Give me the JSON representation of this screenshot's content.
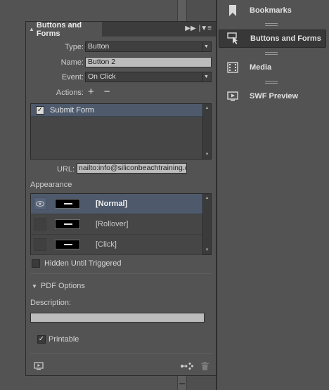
{
  "dock": {
    "items": [
      {
        "label": "Bookmarks",
        "icon": "bookmark-icon"
      },
      {
        "label": "Buttons and Forms",
        "icon": "buttons-forms-icon"
      },
      {
        "label": "Media",
        "icon": "media-icon"
      },
      {
        "label": "SWF Preview",
        "icon": "swf-preview-icon"
      }
    ],
    "active_index": 1
  },
  "panel": {
    "title": "Buttons and Forms",
    "type_label": "Type:",
    "type_value": "Button",
    "name_label": "Name:",
    "name_value": "Button 2",
    "event_label": "Event:",
    "event_value": "On Click",
    "actions_label": "Actions:",
    "add_glyph": "+",
    "remove_glyph": "−",
    "actions_list": [
      {
        "label": "Submit Form",
        "checked": true,
        "selected": true
      }
    ],
    "url_label": "URL:",
    "url_value": "nailto:info@siliconbeachtraining.co.uk",
    "appearance_label": "Appearance",
    "appearance_states": [
      {
        "label": "[Normal]",
        "selected": true
      },
      {
        "label": "[Rollover]",
        "selected": false
      },
      {
        "label": "[Click]",
        "selected": false
      }
    ],
    "hidden_until_triggered_label": "Hidden Until Triggered",
    "hidden_until_triggered_checked": false,
    "pdf_options_label": "PDF Options",
    "description_label": "Description:",
    "description_value": "",
    "printable_label": "Printable",
    "printable_checked": true
  },
  "colors": {
    "panel_bg": "#535353",
    "selection": "#4e5a6c",
    "field_bg": "#bcbcbc"
  }
}
